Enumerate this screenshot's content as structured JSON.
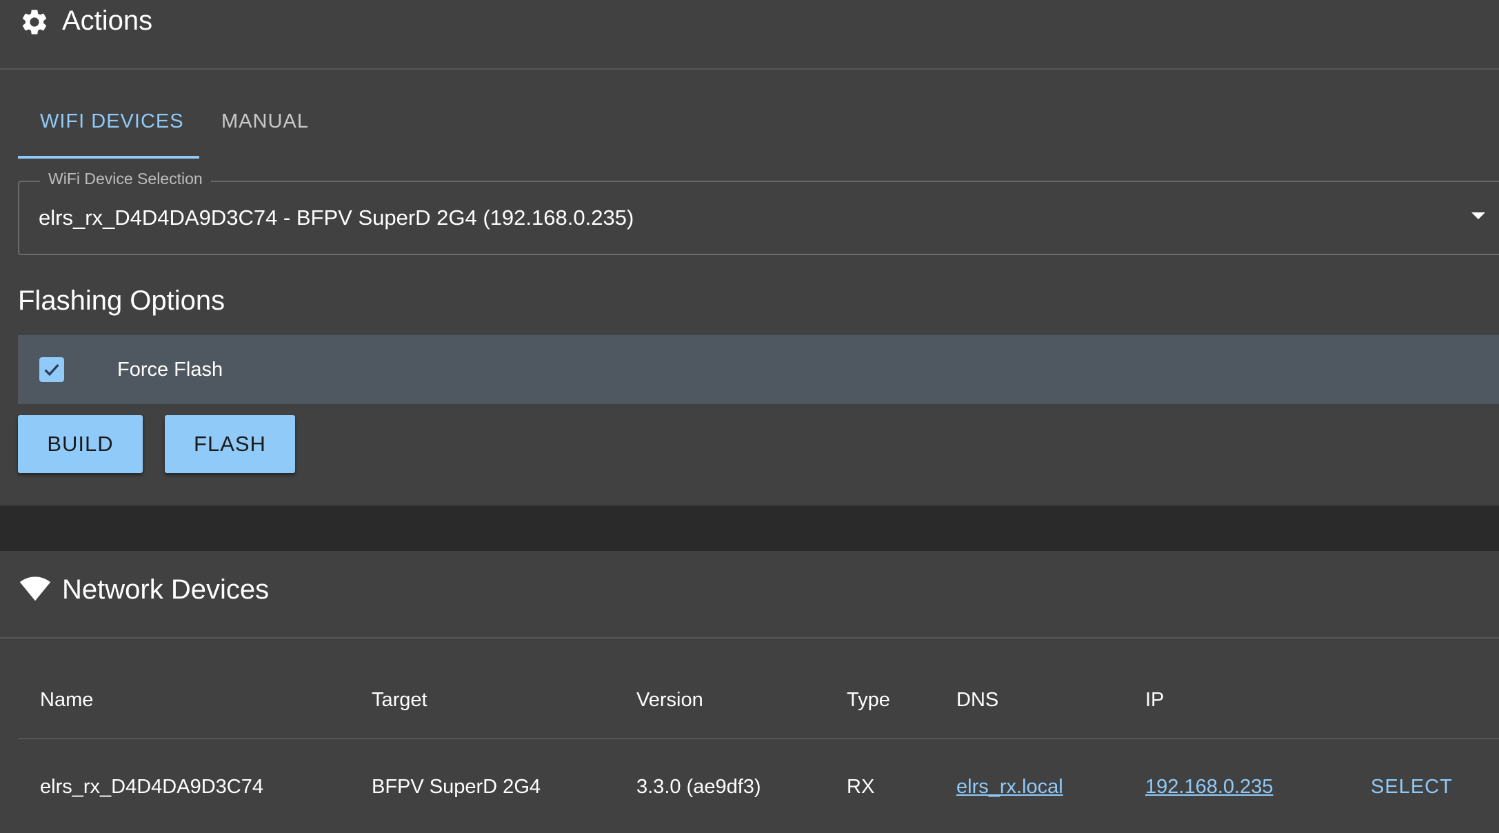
{
  "actions": {
    "title": "Actions",
    "icon": "gear-icon",
    "tabs": [
      {
        "label": "WIFI DEVICES",
        "active": true
      },
      {
        "label": "MANUAL",
        "active": false
      }
    ],
    "device_select": {
      "legend": "WiFi Device Selection",
      "value": "elrs_rx_D4D4DA9D3C74 - BFPV SuperD 2G4 (192.168.0.235)"
    },
    "flashing_options": {
      "title": "Flashing Options",
      "force_flash": {
        "label": "Force Flash",
        "checked": true
      }
    },
    "buttons": {
      "build": "BUILD",
      "flash": "FLASH"
    }
  },
  "network_devices": {
    "title": "Network Devices",
    "icon": "wifi-icon",
    "columns": [
      "Name",
      "Target",
      "Version",
      "Type",
      "DNS",
      "IP"
    ],
    "rows": [
      {
        "name": "elrs_rx_D4D4DA9D3C74",
        "target": "BFPV SuperD 2G4",
        "version": "3.3.0 (ae9df3)",
        "type": "RX",
        "dns": "elrs_rx.local",
        "ip": "192.168.0.235",
        "action": "SELECT"
      }
    ]
  },
  "colors": {
    "accent": "#90caf9",
    "card": "#414141",
    "background": "#2a2a2a"
  }
}
